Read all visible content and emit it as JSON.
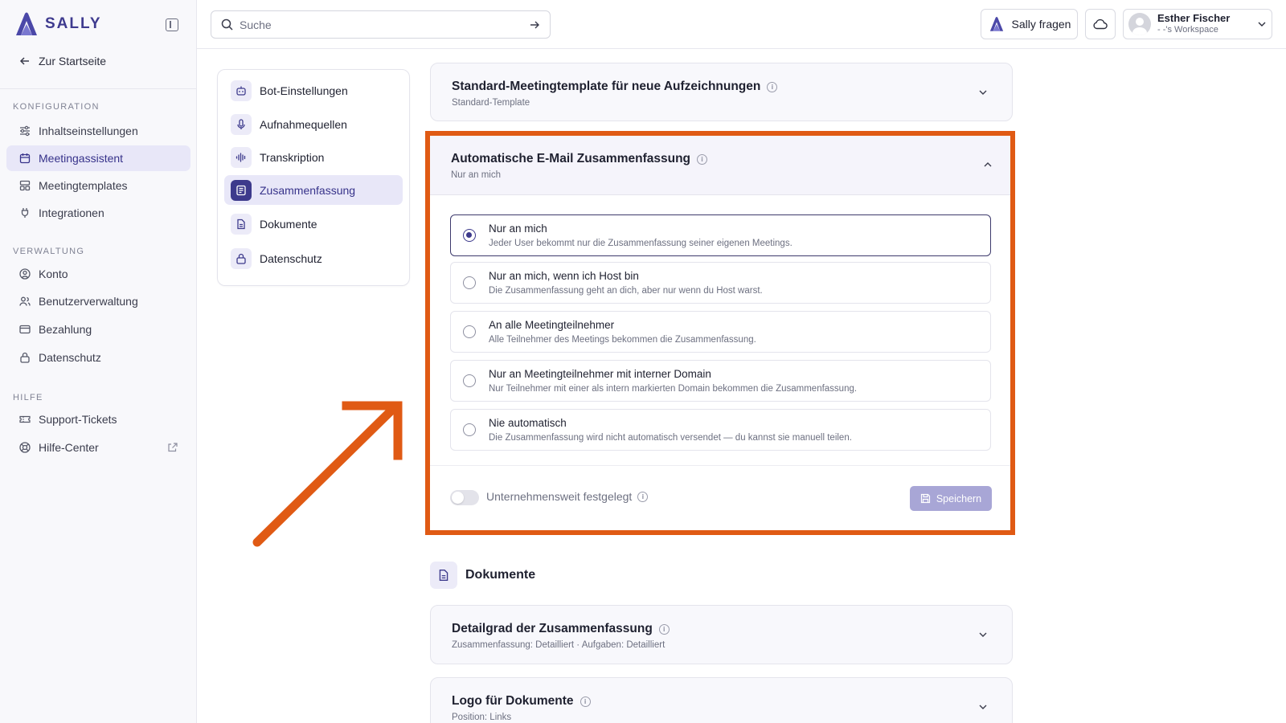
{
  "brand": {
    "name": "SALLY"
  },
  "sidebar": {
    "back_label": "Zur Startseite",
    "sections": [
      {
        "title": "KONFIGURATION",
        "items": [
          "Inhaltseinstellungen",
          "Meetingassistent",
          "Meetingtemplates",
          "Integrationen"
        ]
      },
      {
        "title": "VERWALTUNG",
        "items": [
          "Konto",
          "Benutzerverwaltung",
          "Bezahlung",
          "Datenschutz"
        ]
      },
      {
        "title": "HILFE",
        "items": [
          "Support-Tickets",
          "Hilfe-Center"
        ]
      }
    ],
    "active_item": "Meetingassistent"
  },
  "topbar": {
    "search_placeholder": "Suche",
    "ask_label": "Sally fragen",
    "user_name": "Esther Fischer",
    "user_workspace": "- -'s Workspace"
  },
  "subnav": {
    "items": [
      "Bot-Einstellungen",
      "Aufnahmequellen",
      "Transkription",
      "Zusammenfassung",
      "Dokumente",
      "Datenschutz"
    ],
    "active_item": "Zusammenfassung"
  },
  "cards": {
    "template": {
      "title": "Standard-Meetingtemplate für neue Aufzeichnungen",
      "subtitle": "Standard-Template"
    },
    "email": {
      "title": "Automatische E-Mail Zusammenfassung",
      "subtitle": "Nur an mich",
      "options": [
        {
          "title": "Nur an mich",
          "desc": "Jeder User bekommt nur die Zusammenfassung seiner eigenen Meetings.",
          "selected": true
        },
        {
          "title": "Nur an mich, wenn ich Host bin",
          "desc": "Die Zusammenfassung geht an dich, aber nur wenn du Host warst.",
          "selected": false
        },
        {
          "title": "An alle Meetingteilnehmer",
          "desc": "Alle Teilnehmer des Meetings bekommen die Zusammenfassung.",
          "selected": false
        },
        {
          "title": "Nur an Meetingteilnehmer mit interner Domain",
          "desc": "Nur Teilnehmer mit einer als intern markierten Domain bekommen die Zusammenfassung.",
          "selected": false
        },
        {
          "title": "Nie automatisch",
          "desc": "Die Zusammenfassung wird nicht automatisch versendet — du kannst sie manuell teilen.",
          "selected": false
        }
      ],
      "toggle_label": "Unternehmensweit festgelegt",
      "toggle_on": false,
      "save_label": "Speichern"
    },
    "documents_section": "Dokumente",
    "detail": {
      "title": "Detailgrad der Zusammenfassung",
      "subtitle": "Zusammenfassung: Detailliert · Aufgaben: Detailliert"
    },
    "logo": {
      "title": "Logo für Dokumente",
      "subtitle": "Position: Links"
    }
  },
  "colors": {
    "accent": "#3d3a8c",
    "highlight": "#e05a14",
    "active_bg": "#e8e7f8"
  }
}
